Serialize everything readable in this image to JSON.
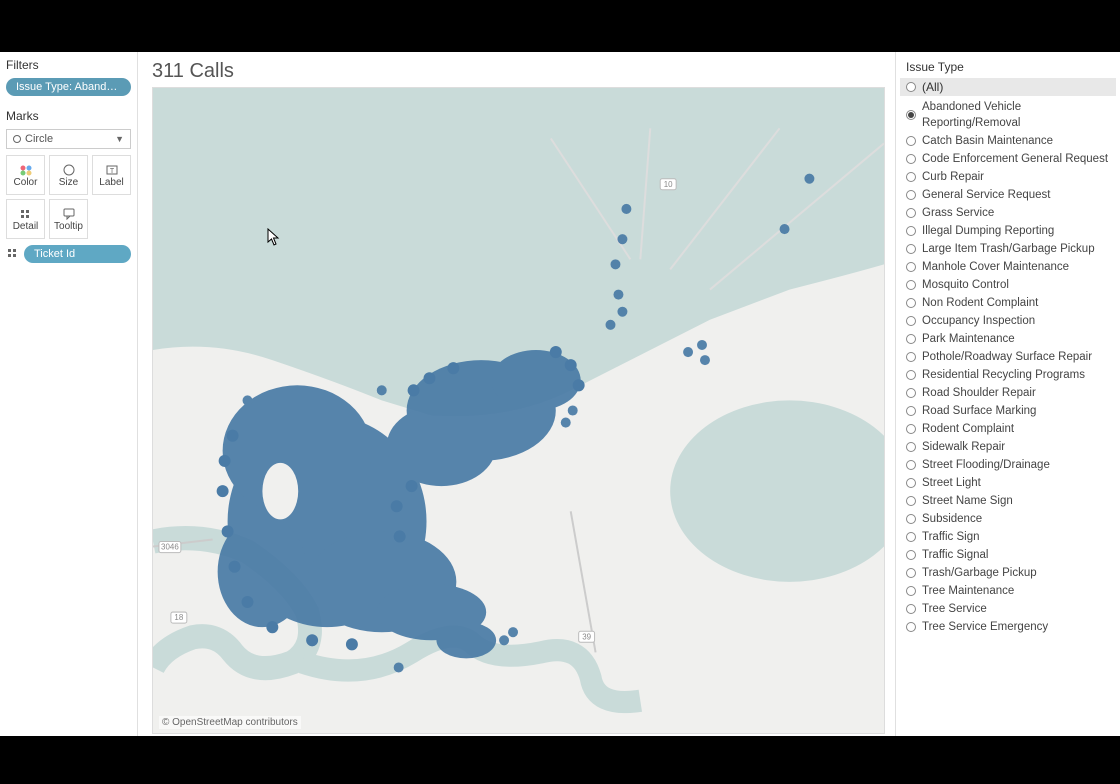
{
  "left": {
    "filters_title": "Filters",
    "filter_pill": "Issue Type: Abandon..",
    "marks_title": "Marks",
    "marks_dropdown": "Circle",
    "mark_buttons": [
      "Color",
      "Size",
      "Label",
      "Detail",
      "Tooltip"
    ],
    "detail_pill": "Ticket Id"
  },
  "center": {
    "title": "311 Calls",
    "attribution": "© OpenStreetMap contributors"
  },
  "right": {
    "title": "Issue Type",
    "all_label": "(All)",
    "selected_index": 0,
    "items": [
      "Abandoned Vehicle Reporting/Removal",
      "Catch Basin Maintenance",
      "Code Enforcement General Request",
      "Curb Repair",
      "General Service Request",
      "Grass Service",
      "Illegal Dumping Reporting",
      "Large Item Trash/Garbage Pickup",
      "Manhole Cover Maintenance",
      "Mosquito Control",
      "Non Rodent Complaint",
      "Occupancy Inspection",
      "Park Maintenance",
      "Pothole/Roadway Surface Repair",
      "Residential Recycling Programs",
      "Road Shoulder Repair",
      "Road Surface Marking",
      "Rodent Complaint",
      "Sidewalk Repair",
      "Street Flooding/Drainage",
      "Street Light",
      "Street Name Sign",
      "Subsidence",
      "Traffic Sign",
      "Traffic Signal",
      "Trash/Garbage Pickup",
      "Tree Maintenance",
      "Tree Service",
      "Tree Service Emergency"
    ]
  },
  "map": {
    "location": "New Orleans, LA area",
    "water_color": "#c9dbd9",
    "land_color": "#f0f0ee",
    "dot_color": "#4a7ba6",
    "road_labels": [
      "3046",
      "18",
      "39",
      "10"
    ]
  }
}
